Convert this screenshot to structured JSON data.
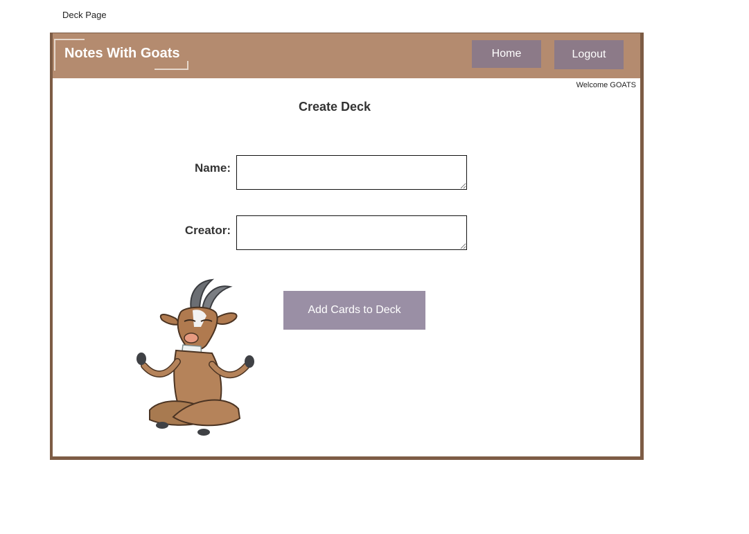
{
  "page_label": "Deck Page",
  "header": {
    "logo_text": "Notes With Goats",
    "nav": {
      "home_label": "Home",
      "logout_label": "Logout"
    },
    "colors": {
      "header_bg": "#b48b6f",
      "frame_border": "#7d5c45",
      "nav_button_bg": "#8c7a88"
    }
  },
  "welcome_text": "Welcome GOATS",
  "form": {
    "title": "Create Deck",
    "name_label": "Name:",
    "name_value": "",
    "creator_label": "Creator:",
    "creator_value": "",
    "submit_label": "Add Cards to Deck",
    "submit_color": "#9a8fa5"
  },
  "illustration": {
    "icon": "meditating-goat-mascot"
  }
}
